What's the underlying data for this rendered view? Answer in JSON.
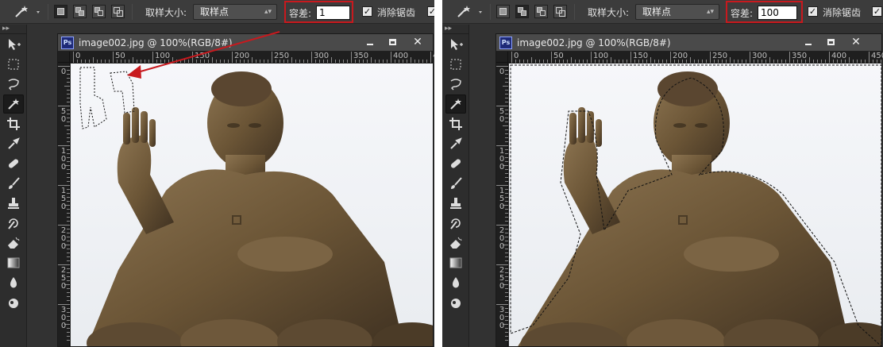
{
  "options_bar": {
    "tool_icon": "magic-wand-icon",
    "sample_size_label": "取样大小:",
    "sample_size_value": "取样点",
    "tolerance_label": "容差:",
    "antialias_label": "消除锯齿"
  },
  "screens": [
    {
      "tolerance_value": "1",
      "document_title": "image002.jpg @ 100%(RGB/8#)"
    },
    {
      "tolerance_value": "100",
      "document_title": "image002.jpg @ 100%(RGB/8#)"
    }
  ],
  "ruler": {
    "top_ticks": [
      "0",
      "50",
      "100",
      "150",
      "200",
      "250",
      "300",
      "350",
      "400",
      "450"
    ],
    "left_ticks": [
      "0",
      "50",
      "100",
      "150",
      "200",
      "250",
      "300"
    ]
  },
  "toolbox": {
    "header": "▸▸",
    "tools": [
      "move-icon",
      "marquee-icon",
      "lasso-icon",
      "magic-wand-icon",
      "crop-icon",
      "eyedropper-icon",
      "healing-brush-icon",
      "brush-icon",
      "stamp-icon",
      "history-brush-icon",
      "eraser-icon",
      "gradient-icon",
      "blur-icon",
      "smudge-icon"
    ]
  },
  "colors": {
    "annotation_red": "#c8191e",
    "statue_bronze": "#6a553a",
    "panel_bg": "#323232"
  }
}
